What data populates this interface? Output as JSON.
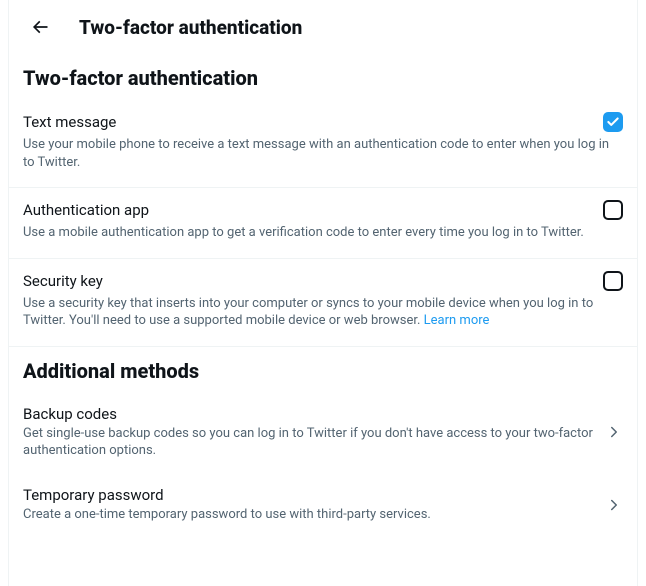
{
  "header": {
    "title": "Two-factor authentication"
  },
  "section1": {
    "title": "Two-factor authentication"
  },
  "methods": {
    "text_message": {
      "label": "Text message",
      "desc": "Use your mobile phone to receive a text message with an authentication code to enter when you log in to Twitter.",
      "checked": true
    },
    "auth_app": {
      "label": "Authentication app",
      "desc": "Use a mobile authentication app to get a verification code to enter every time you log in to Twitter.",
      "checked": false
    },
    "security_key": {
      "label": "Security key",
      "desc": "Use a security key that inserts into your computer or syncs to your mobile device when you log in to Twitter. You'll need to use a supported mobile device or web browser. ",
      "learn_more": "Learn more",
      "checked": false
    }
  },
  "section2": {
    "title": "Additional methods"
  },
  "additional": {
    "backup_codes": {
      "label": "Backup codes",
      "desc": "Get single-use backup codes so you can log in to Twitter if you don't have access to your two-factor authentication options."
    },
    "temporary_password": {
      "label": "Temporary password",
      "desc": "Create a one-time temporary password to use with third-party services."
    }
  },
  "colors": {
    "accent": "#1d9bf0",
    "text": "#0f1419",
    "muted": "#536471",
    "border": "#eff3f4"
  }
}
